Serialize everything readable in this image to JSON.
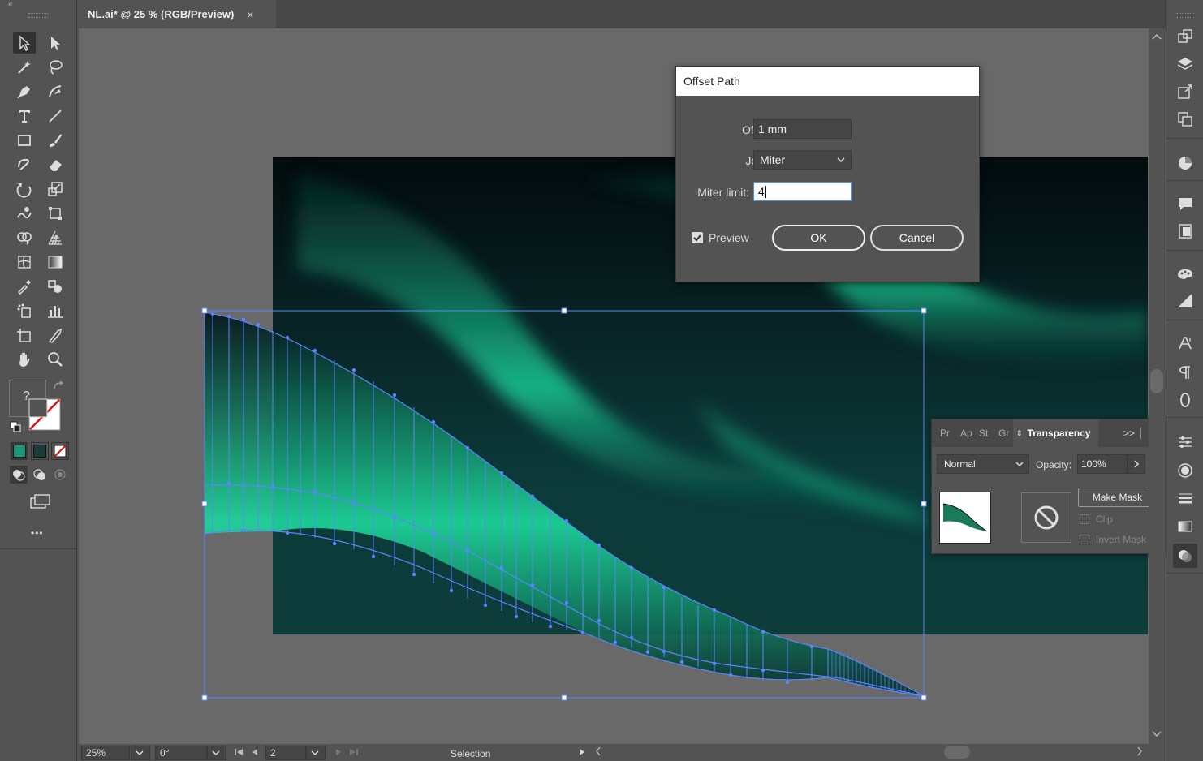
{
  "document": {
    "tab_title": "NL.ai* @ 25 % (RGB/Preview)",
    "close_glyph": "×"
  },
  "toolbar": {
    "collapse_glyph": "«",
    "question_mark": "?",
    "more_glyph": "•••",
    "tools": [
      "selection-tool",
      "direct-selection-tool",
      "magic-wand-tool",
      "lasso-tool",
      "pen-tool",
      "curvature-tool",
      "type-tool",
      "line-tool",
      "rectangle-tool",
      "paintbrush-tool",
      "shaper-tool",
      "eraser-tool",
      "rotate-tool",
      "scale-tool",
      "warp-tool",
      "free-transform-tool",
      "shape-builder-tool",
      "perspective-grid-tool",
      "mesh-tool",
      "gradient-tool",
      "eyedropper-tool",
      "blend-tool",
      "symbol-sprayer-tool",
      "column-graph-tool",
      "artboard-tool",
      "slice-tool",
      "hand-tool",
      "zoom-tool"
    ],
    "fill_color": "#ffffff",
    "swatch_colors": [
      "#1a9a7a",
      "#1b3a3a"
    ]
  },
  "dialog": {
    "title": "Offset Path",
    "offset_label": "Offset:",
    "offset_value": "1 mm",
    "joins_label": "Joins:",
    "joins_value": "Miter",
    "miter_label": "Miter limit:",
    "miter_value": "4",
    "preview_label": "Preview",
    "preview_checked": true,
    "ok_label": "OK",
    "cancel_label": "Cancel"
  },
  "transparency_panel": {
    "tabs": [
      "Pr",
      "Ap",
      "St",
      "Gr"
    ],
    "active_tab": "Transparency",
    "expand_glyph": ">>",
    "blend_mode": "Normal",
    "opacity_label": "Opacity:",
    "opacity_value": "100%",
    "make_mask_label": "Make Mask",
    "clip_label": "Clip",
    "invert_mask_label": "Invert Mask"
  },
  "status_bar": {
    "zoom": "25%",
    "rotation": "0°",
    "artboard_number": "2",
    "current_tool": "Selection"
  },
  "colors": {
    "accent_selection": "#4a7cff",
    "aurora_green": "#1ed69a",
    "ui_bg": "#535353",
    "canvas_bg": "#696969"
  }
}
